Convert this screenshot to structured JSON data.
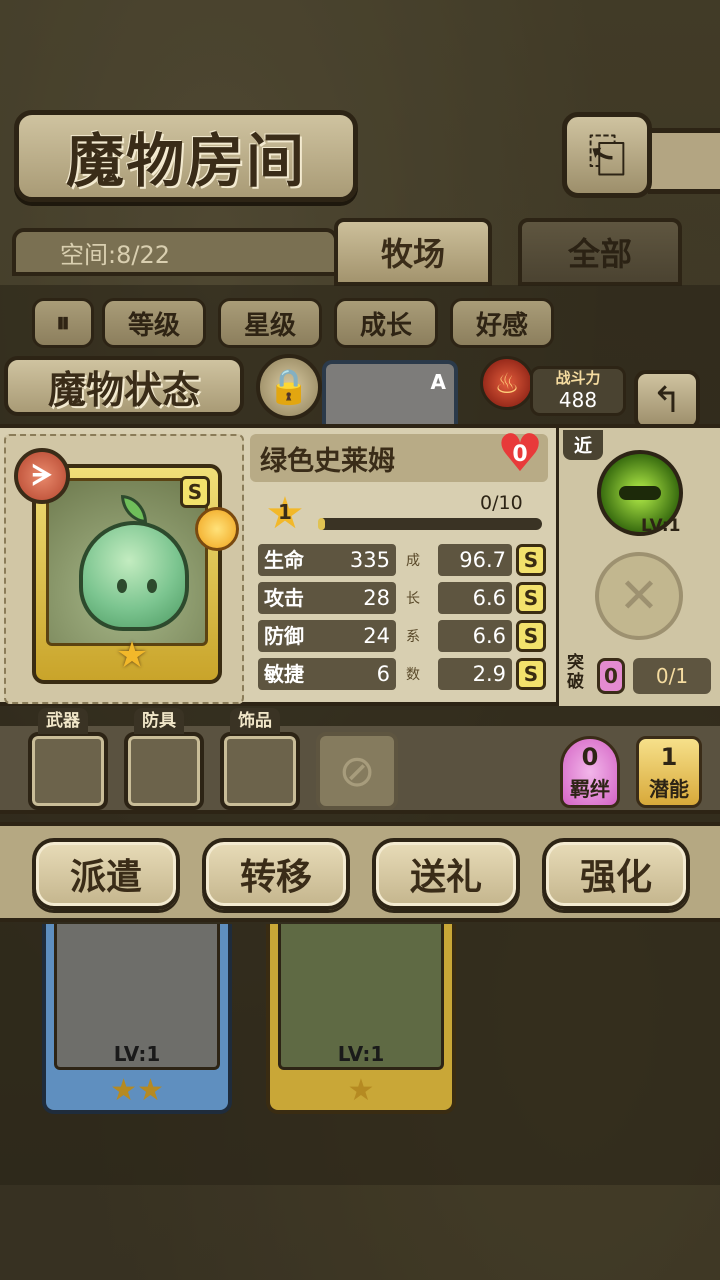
{
  "header": {
    "title": "魔物房间",
    "back_icon": "⎗"
  },
  "tabs": {
    "space_label": "空间:8/22",
    "items": [
      {
        "label": "牧场",
        "active": true
      },
      {
        "label": "全部",
        "active": false
      }
    ]
  },
  "filters": {
    "pause_icon": "⏸",
    "items": [
      "等级",
      "星级",
      "成长",
      "好感"
    ]
  },
  "status": {
    "title": "魔物状态",
    "lock_icon": "🔒",
    "power_label": "战斗力",
    "power_value": "488",
    "back_icon": "↰",
    "card_rank_a": "A"
  },
  "monster": {
    "name": "绿色史莱姆",
    "affection": "0",
    "rank": "S",
    "element_icon": "ᗒ",
    "star": "★",
    "level": "1",
    "exp_text": "0/10",
    "exp_fraction": 0.0,
    "stats": [
      {
        "name": "生命",
        "value": "335",
        "growth_char": "成",
        "growth": "96.7",
        "grade": "S"
      },
      {
        "name": "攻击",
        "value": "28",
        "growth_char": "长",
        "growth": "6.6",
        "grade": "S"
      },
      {
        "name": "防御",
        "value": "24",
        "growth_char": "系",
        "growth": "6.6",
        "grade": "S"
      },
      {
        "name": "敏捷",
        "value": "6",
        "growth_char": "数",
        "growth": "2.9",
        "grade": "S"
      }
    ]
  },
  "skills": {
    "range": "近",
    "skill_level": "LV:1",
    "empty_icon": "✕",
    "breakthrough_label": "突破",
    "breakthrough_count": "0",
    "breakthrough_progress": "0/1"
  },
  "equipment": {
    "slots": [
      "武器",
      "防具",
      "饰品"
    ],
    "disabled_icon": "⊘",
    "bond_value": "0",
    "bond_label": "羁绊",
    "potential_value": "1",
    "potential_label": "潜能"
  },
  "actions": [
    "派遣",
    "转移",
    "送礼",
    "强化"
  ],
  "list": [
    {
      "level": "LV:1",
      "stars": "★★"
    },
    {
      "level": "LV:1",
      "stars": "★"
    }
  ],
  "colors": {
    "accent_gold": "#f2b82a",
    "heart_red": "#e83a3a",
    "panel_beige": "#d8cfb1",
    "dark_brown": "#2d2415"
  }
}
